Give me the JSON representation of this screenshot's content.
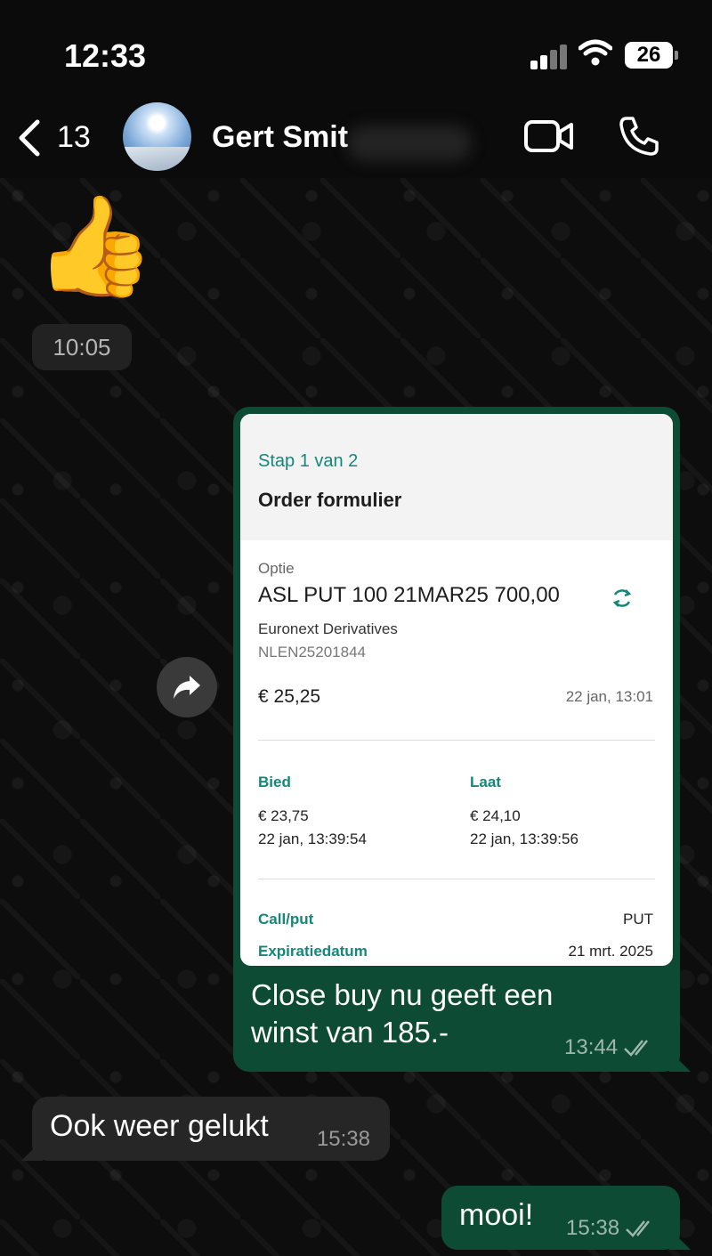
{
  "status_bar": {
    "time": "12:33",
    "battery": "26"
  },
  "header": {
    "back_count": "13",
    "contact_name": "Gert Smit"
  },
  "messages": {
    "thumb": {
      "emoji": "👍",
      "time": "10:05"
    },
    "forwarded": {
      "card": {
        "step": "Stap 1 van 2",
        "title": "Order formulier",
        "option_label": "Optie",
        "option_name": "ASL PUT 100 21MAR25 700,00",
        "exchange": "Euronext Derivatives",
        "isin": "NLEN25201844",
        "price": "€ 25,25",
        "price_time": "22 jan, 13:01",
        "bid_label": "Bied",
        "bid_value": "€ 23,75",
        "bid_time": "22 jan, 13:39:54",
        "ask_label": "Laat",
        "ask_value": "€ 24,10",
        "ask_time": "22 jan, 13:39:56",
        "callput_label": "Call/put",
        "callput_value": "PUT",
        "expiry_label": "Expiratiedatum",
        "expiry_value": "21 mrt. 2025"
      },
      "text": "Close buy nu geeft een winst van 185.-",
      "time": "13:44"
    },
    "incoming": {
      "text": "Ook weer gelukt",
      "time": "15:38"
    },
    "outgoing": {
      "text": "mooi!",
      "time": "15:38"
    }
  },
  "colors": {
    "outgoing_bubble": "#0e4b35",
    "incoming_bubble": "#262626",
    "accent": "#13877a"
  }
}
